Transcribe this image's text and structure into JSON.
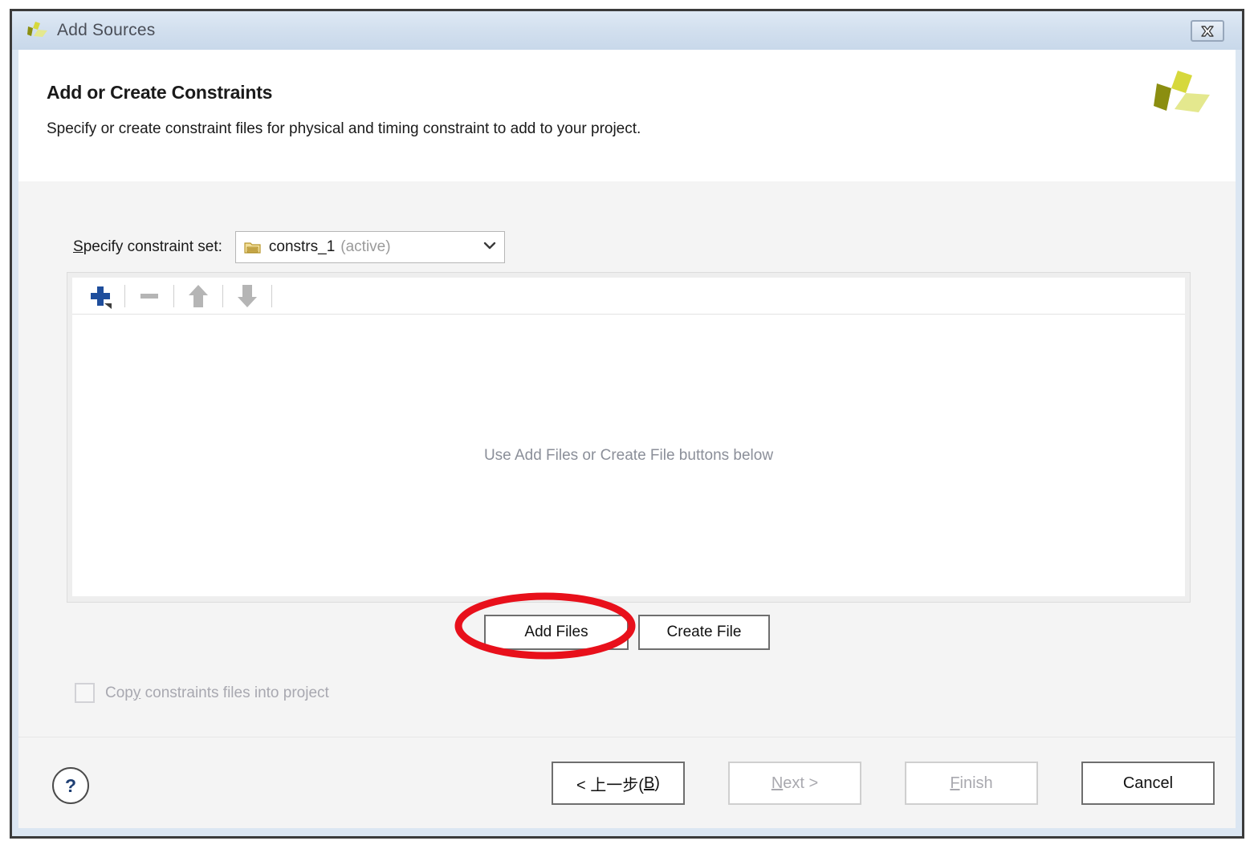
{
  "window": {
    "title": "Add Sources",
    "logo_icon": "xilinx-logo-icon",
    "close_icon": "close-icon"
  },
  "header": {
    "title": "Add or Create Constraints",
    "subtitle": "Specify or create constraint files for physical and timing constraint to add to your project.",
    "brand_icon": "xilinx-logo-icon"
  },
  "constraint_set": {
    "label_prefix": "S",
    "label_rest": "pecify constraint set:",
    "folder_icon": "folder-icon",
    "value": "constrs_1",
    "state": "(active)",
    "dropdown_icon": "chevron-down-icon"
  },
  "list_toolbar": {
    "add_icon": "plus-icon",
    "remove_icon": "minus-icon",
    "move_up_icon": "arrow-up-icon",
    "move_down_icon": "arrow-down-icon"
  },
  "file_list": {
    "empty_message": "Use Add Files or Create File buttons below"
  },
  "actions": {
    "add_files": "Add Files",
    "create_file": "Create File"
  },
  "copy_option": {
    "checked": false,
    "label_a": "Cop",
    "label_mn": "y",
    "label_b": " constraints files into project"
  },
  "footer": {
    "help_label": "?",
    "back_a": "< 上一步(",
    "back_mn": "B",
    "back_b": ")",
    "next_mn": "N",
    "next_rest": "ext >",
    "finish_mn": "F",
    "finish_rest": "inish",
    "cancel": "Cancel"
  },
  "annotation": {
    "shape": "ellipse",
    "color": "#e8101b",
    "target": "Add Files"
  },
  "colors": {
    "titlebar_top": "#dfeaf5",
    "titlebar_bottom": "#c8d8ea",
    "frame_border": "#3b3b3b",
    "frame_inner": "#dbe6f2",
    "body_bg": "#f4f4f4",
    "panel_bg": "#ffffff",
    "accent_blue": "#1f4e9c",
    "brand_olive": "#a8ae1e",
    "annotation_red": "#e8101b"
  }
}
